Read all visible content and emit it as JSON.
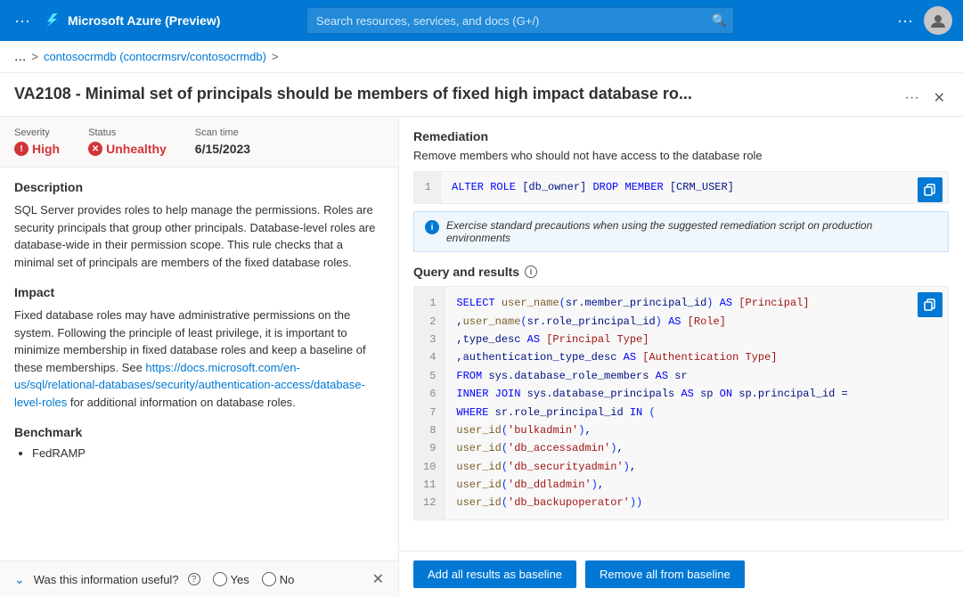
{
  "topbar": {
    "title": "Microsoft Azure (Preview)",
    "search_placeholder": "Search resources, services, and docs (G+/)"
  },
  "breadcrumb": {
    "dots": "...",
    "separator": ">",
    "link_text": "contosocrmdb (contocrmsrv/contosocrmdb)",
    "trailing_sep": ">"
  },
  "panel": {
    "title": "VA2108 - Minimal set of principals should be members of fixed high impact database ro...",
    "severity_label": "Severity",
    "severity_value": "High",
    "status_label": "Status",
    "status_value": "Unhealthy",
    "scan_time_label": "Scan time",
    "scan_time_value": "6/15/2023"
  },
  "description": {
    "heading": "Description",
    "text": "SQL Server provides roles to help manage the permissions. Roles are security principals that group other principals. Database-level roles are database-wide in their permission scope. This rule checks that a minimal set of principals are members of the fixed database roles."
  },
  "impact": {
    "heading": "Impact",
    "text": "Fixed database roles may have administrative permissions on the system. Following the principle of least privilege, it is important to minimize membership in fixed database roles and keep a baseline of these memberships. See https://docs.microsoft.com/en-us/sql/relational-databases/security/authentication-access/database-level-roles for additional information on database roles."
  },
  "benchmark": {
    "heading": "Benchmark",
    "item": "FedRAMP"
  },
  "feedback": {
    "question": "Was this information useful?",
    "yes_label": "Yes",
    "no_label": "No"
  },
  "remediation": {
    "heading": "Remediation",
    "description": "Remove members who should not have access to the database role",
    "line_num": "1",
    "code": "ALTER ROLE [db_owner] DROP MEMBER [CRM_USER]",
    "info_text": "Exercise standard precautions when using the suggested remediation script on production environments",
    "copy_tooltip": "Copy"
  },
  "query": {
    "heading": "Query and results",
    "lines": [
      {
        "num": "1",
        "code": "SELECT user_name(sr.member_principal_id) AS [Principal]"
      },
      {
        "num": "2",
        "code": "     ,user_name(sr.role_principal_id) AS [Role]"
      },
      {
        "num": "3",
        "code": "     ,type_desc AS [Principal Type]"
      },
      {
        "num": "4",
        "code": "     ,authentication_type_desc AS [Authentication Type]"
      },
      {
        "num": "5",
        "code": "FROM sys.database_role_members AS sr"
      },
      {
        "num": "6",
        "code": "INNER JOIN sys.database_principals AS sp ON sp.principal_id ="
      },
      {
        "num": "7",
        "code": "WHERE sr.role_principal_id IN ("
      },
      {
        "num": "8",
        "code": "          user_id('bulkadmin'),"
      },
      {
        "num": "9",
        "code": "          user_id('db_accessadmin'),"
      },
      {
        "num": "10",
        "code": "          user_id('db_securityadmin'),"
      },
      {
        "num": "11",
        "code": "          user_id('db_ddladmin'),"
      },
      {
        "num": "12",
        "code": "          user_id('db_backupoperator'))"
      }
    ]
  },
  "actions": {
    "add_baseline_label": "Add all results as baseline",
    "remove_baseline_label": "Remove all from baseline"
  }
}
